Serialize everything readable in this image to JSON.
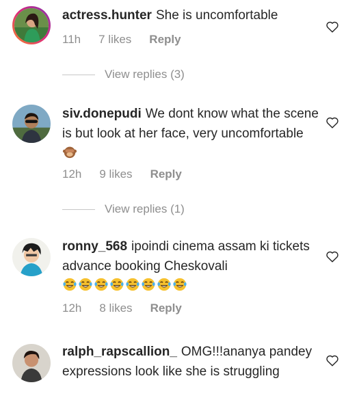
{
  "comments": [
    {
      "username": "actress.hunter",
      "text": "She is uncomfortable",
      "time": "11h",
      "likes": "7 likes",
      "reply": "Reply",
      "view_replies": "View replies (3)",
      "avatar": "avatar-woman-green-dress"
    },
    {
      "username": "siv.donepudi",
      "text": "We dont know what the scene is but look at her face,  very uncomfortable",
      "emoji": "see-no-evil-monkey",
      "time": "12h",
      "likes": "9 likes",
      "reply": "Reply",
      "view_replies": "View replies (1)",
      "avatar": "avatar-man-sunglasses"
    },
    {
      "username": "ronny_568",
      "text": "ipoindi cinema assam ki tickets advance booking Cheskovali",
      "emoji": "tears-of-joy-x8",
      "time": "12h",
      "likes": "8 likes",
      "reply": "Reply",
      "avatar": "avatar-cartoon-boy"
    },
    {
      "username": "ralph_rapscallion_",
      "text": "OMG!!!ananya pandey expressions look like she is struggling",
      "avatar": "avatar-man-portrait"
    }
  ],
  "icons": {
    "like": "heart-outline-icon"
  },
  "colors": {
    "text": "#262626",
    "muted": "#8e8e8e",
    "divider": "#c7c7c7"
  }
}
